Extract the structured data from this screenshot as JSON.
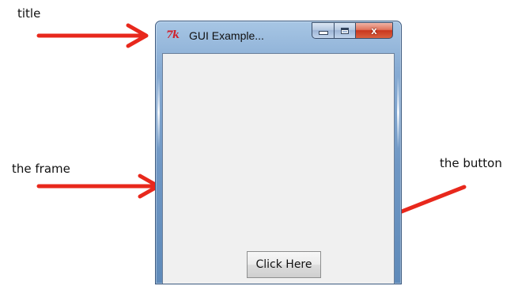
{
  "annotations": {
    "title": "title",
    "frame": "the frame",
    "button": "the button"
  },
  "window": {
    "app_icon_text": "7k",
    "title": "GUI Example...",
    "close_glyph": "x",
    "button_label": "Click Here"
  },
  "colors": {
    "arrow": "#e8281c",
    "close_button": "#c8361e",
    "app_icon": "#d0202a",
    "client_background": "#f0f0f0"
  },
  "icons": {
    "app": "tk-feather-icon",
    "minimize": "minimize-icon",
    "maximize": "maximize-icon",
    "close": "close-icon",
    "arrows": "arrow-icon"
  }
}
